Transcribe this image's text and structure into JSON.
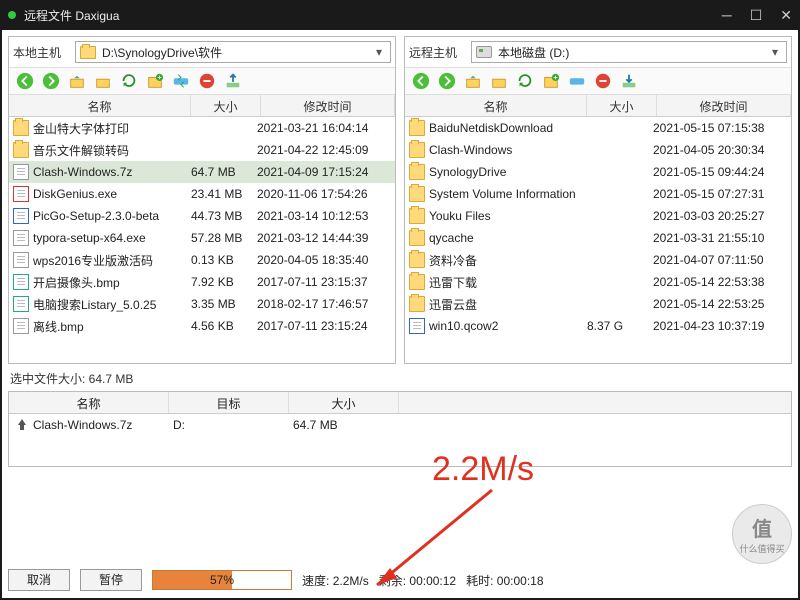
{
  "title": "远程文件 Daxigua",
  "local": {
    "label": "本地主机",
    "path": "D:\\SynologyDrive\\软件",
    "columns": {
      "name": "名称",
      "size": "大小",
      "date": "修改时间"
    },
    "rows": [
      {
        "icon": "folder",
        "name": "金山特大字体打印",
        "size": "",
        "date": "2021-03-21 16:04:14"
      },
      {
        "icon": "folder",
        "name": "音乐文件解锁转码",
        "size": "",
        "date": "2021-04-22 12:45:09"
      },
      {
        "icon": "file",
        "name": "Clash-Windows.7z",
        "size": "64.7 MB",
        "date": "2021-04-09 17:15:24",
        "sel": true
      },
      {
        "icon": "file-red",
        "name": "DiskGenius.exe",
        "size": "23.41 MB",
        "date": "2020-11-06 17:54:26"
      },
      {
        "icon": "file-blue",
        "name": "PicGo-Setup-2.3.0-beta",
        "size": "44.73 MB",
        "date": "2021-03-14 10:12:53"
      },
      {
        "icon": "file",
        "name": "typora-setup-x64.exe",
        "size": "57.28 MB",
        "date": "2021-03-12 14:44:39"
      },
      {
        "icon": "file",
        "name": "wps2016专业版激活码",
        "size": "0.13 KB",
        "date": "2020-04-05 18:35:40"
      },
      {
        "icon": "file-green",
        "name": "开启摄像头.bmp",
        "size": "7.92 KB",
        "date": "2017-07-11 23:15:37"
      },
      {
        "icon": "file-green",
        "name": "电脑搜索Listary_5.0.25",
        "size": "3.35 MB",
        "date": "2018-02-17 17:46:57"
      },
      {
        "icon": "file",
        "name": "离线.bmp",
        "size": "4.56 KB",
        "date": "2017-07-11 23:15:24"
      }
    ]
  },
  "remote": {
    "label": "远程主机",
    "path": "本地磁盘 (D:)",
    "columns": {
      "name": "名称",
      "size": "大小",
      "date": "修改时间"
    },
    "rows": [
      {
        "icon": "folder",
        "name": "BaiduNetdiskDownload",
        "size": "",
        "date": "2021-05-15 07:15:38"
      },
      {
        "icon": "folder",
        "name": "Clash-Windows",
        "size": "",
        "date": "2021-04-05 20:30:34"
      },
      {
        "icon": "folder",
        "name": "SynologyDrive",
        "size": "",
        "date": "2021-05-15 09:44:24"
      },
      {
        "icon": "folder",
        "name": "System Volume Information",
        "size": "",
        "date": "2021-05-15 07:27:31"
      },
      {
        "icon": "folder",
        "name": "Youku Files",
        "size": "",
        "date": "2021-03-03 20:25:27"
      },
      {
        "icon": "folder",
        "name": "qycache",
        "size": "",
        "date": "2021-03-31 21:55:10"
      },
      {
        "icon": "folder",
        "name": "资料冷备",
        "size": "",
        "date": "2021-04-07 07:11:50"
      },
      {
        "icon": "folder",
        "name": "迅雷下载",
        "size": "",
        "date": "2021-05-14 22:53:38"
      },
      {
        "icon": "folder",
        "name": "迅雷云盘",
        "size": "",
        "date": "2021-05-14 22:53:25"
      },
      {
        "icon": "file-blue",
        "name": "win10.qcow2",
        "size": "8.37 G",
        "date": "2021-04-23 10:37:19"
      }
    ]
  },
  "selection_label": "选中文件大小: 64.7 MB",
  "queue": {
    "columns": {
      "name": "名称",
      "dest": "目标",
      "size": "大小"
    },
    "rows": [
      {
        "name": "Clash-Windows.7z",
        "dest": "D:",
        "size": "64.7 MB"
      }
    ]
  },
  "annotation": "2.2M/s",
  "buttons": {
    "cancel": "取消",
    "pause": "暂停"
  },
  "progress": {
    "pct": 57,
    "text": "57%"
  },
  "status": {
    "speed_label": "速度:",
    "speed": "2.2M/s",
    "remain_label": "剩余:",
    "remain": "00:00:12",
    "elapsed_label": "耗时:",
    "elapsed": "00:00:18"
  },
  "watermark": {
    "big": "值",
    "small": "什么值得买"
  }
}
